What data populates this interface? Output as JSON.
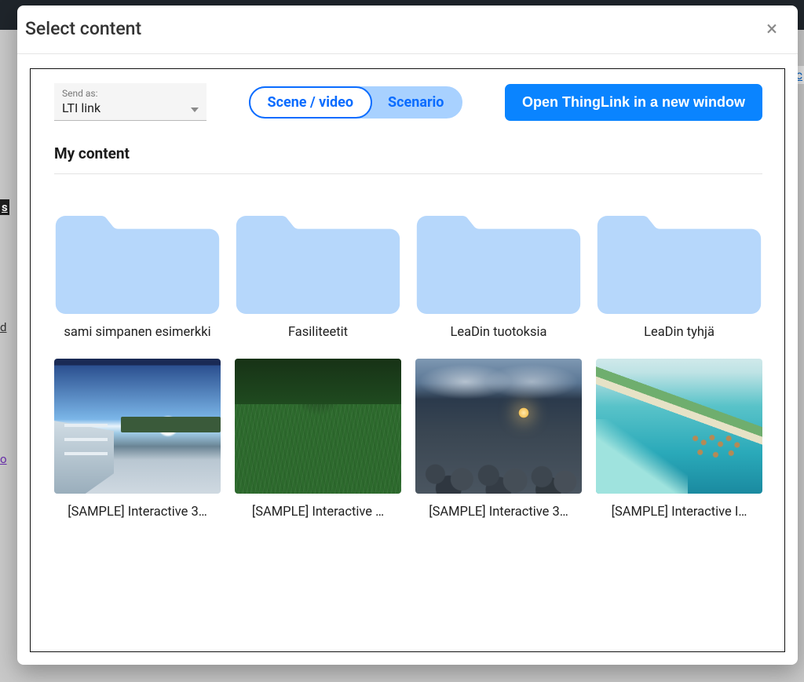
{
  "modal": {
    "title": "Select content"
  },
  "send_as": {
    "label": "Send as:",
    "value": "LTI link"
  },
  "toggle": {
    "options": [
      "Scene / video",
      "Scenario"
    ],
    "active_index": 0
  },
  "open_button_label": "Open ThingLink in a new window",
  "section_title": "My content",
  "folders": [
    {
      "label": "sami simpanen esimerkki"
    },
    {
      "label": "Fasiliteetit"
    },
    {
      "label": "LeaDin tuotoksia"
    },
    {
      "label": "LeaDin tyhjä"
    }
  ],
  "scenes": [
    {
      "label": "[SAMPLE] Interactive 3…",
      "thumb": "lake"
    },
    {
      "label": "[SAMPLE] Interactive …",
      "thumb": "grass"
    },
    {
      "label": "[SAMPLE] Interactive 3…",
      "thumb": "rocks"
    },
    {
      "label": "[SAMPLE] Interactive I…",
      "thumb": "island"
    }
  ],
  "colors": {
    "folder_fill": "#b6d7fb",
    "primary_blue": "#0a6cff",
    "button_blue": "#0a84ff"
  }
}
